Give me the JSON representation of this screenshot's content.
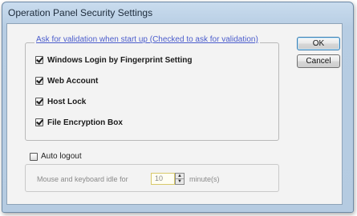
{
  "window": {
    "title": "Operation Panel Security Settings"
  },
  "validation": {
    "legend": "Ask for validation when start up (Checked to ask for validation)",
    "items": [
      {
        "label": "Windows Login by Fingerprint Setting",
        "checked": true
      },
      {
        "label": "Web Account",
        "checked": true
      },
      {
        "label": "Host Lock",
        "checked": true
      },
      {
        "label": "File Encryption Box",
        "checked": true
      }
    ]
  },
  "buttons": {
    "ok": "OK",
    "cancel": "Cancel"
  },
  "auto_logout": {
    "label": "Auto logout",
    "checked": false,
    "idle_label": "Mouse and keyboard idle for",
    "idle_value": "10",
    "idle_unit": "minute(s)"
  },
  "icons": {
    "spin_up": "▲",
    "spin_down": "▼"
  }
}
